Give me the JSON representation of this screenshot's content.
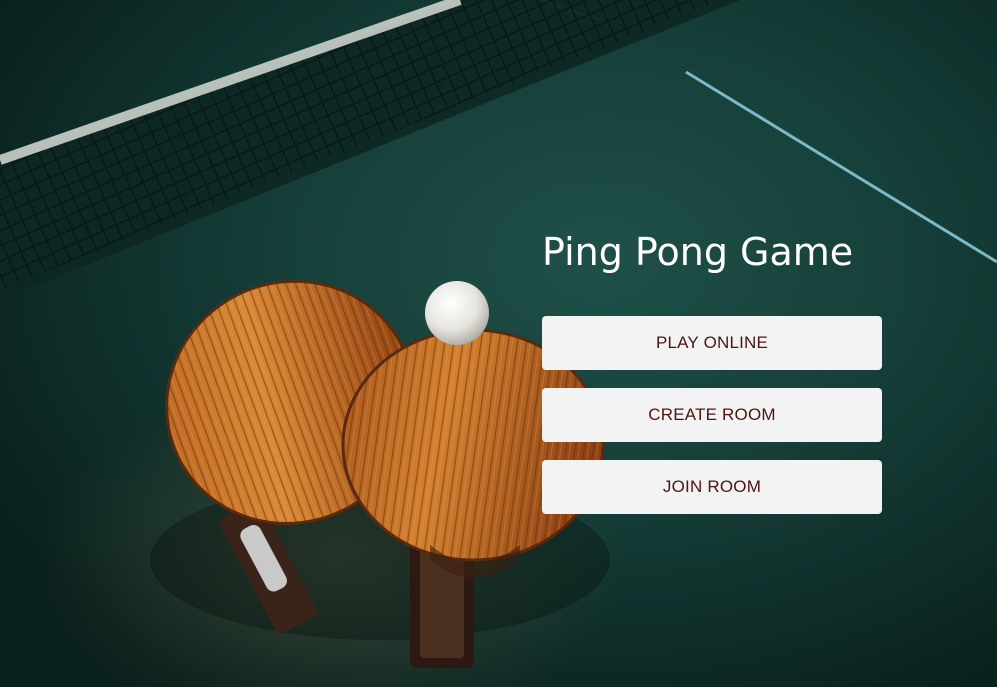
{
  "title": "Ping Pong Game",
  "buttons": {
    "play_online": "PLAY ONLINE",
    "create_room": "CREATE ROOM",
    "join_room": "JOIN ROOM"
  },
  "colors": {
    "button_background": "#f3f3f3",
    "button_text": "#4a1612",
    "title_text": "#ffffff",
    "table": "#1a4640"
  },
  "background": {
    "subject": "ping-pong-table-with-two-paddles-and-ball"
  }
}
